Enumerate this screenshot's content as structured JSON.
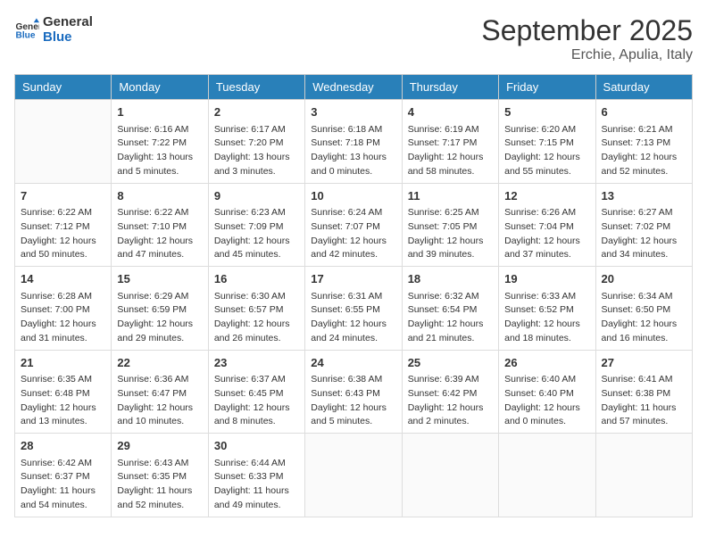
{
  "header": {
    "logo_line1": "General",
    "logo_line2": "Blue",
    "month": "September 2025",
    "location": "Erchie, Apulia, Italy"
  },
  "weekdays": [
    "Sunday",
    "Monday",
    "Tuesday",
    "Wednesday",
    "Thursday",
    "Friday",
    "Saturday"
  ],
  "weeks": [
    [
      {
        "day": "",
        "info": ""
      },
      {
        "day": "1",
        "info": "Sunrise: 6:16 AM\nSunset: 7:22 PM\nDaylight: 13 hours\nand 5 minutes."
      },
      {
        "day": "2",
        "info": "Sunrise: 6:17 AM\nSunset: 7:20 PM\nDaylight: 13 hours\nand 3 minutes."
      },
      {
        "day": "3",
        "info": "Sunrise: 6:18 AM\nSunset: 7:18 PM\nDaylight: 13 hours\nand 0 minutes."
      },
      {
        "day": "4",
        "info": "Sunrise: 6:19 AM\nSunset: 7:17 PM\nDaylight: 12 hours\nand 58 minutes."
      },
      {
        "day": "5",
        "info": "Sunrise: 6:20 AM\nSunset: 7:15 PM\nDaylight: 12 hours\nand 55 minutes."
      },
      {
        "day": "6",
        "info": "Sunrise: 6:21 AM\nSunset: 7:13 PM\nDaylight: 12 hours\nand 52 minutes."
      }
    ],
    [
      {
        "day": "7",
        "info": "Sunrise: 6:22 AM\nSunset: 7:12 PM\nDaylight: 12 hours\nand 50 minutes."
      },
      {
        "day": "8",
        "info": "Sunrise: 6:22 AM\nSunset: 7:10 PM\nDaylight: 12 hours\nand 47 minutes."
      },
      {
        "day": "9",
        "info": "Sunrise: 6:23 AM\nSunset: 7:09 PM\nDaylight: 12 hours\nand 45 minutes."
      },
      {
        "day": "10",
        "info": "Sunrise: 6:24 AM\nSunset: 7:07 PM\nDaylight: 12 hours\nand 42 minutes."
      },
      {
        "day": "11",
        "info": "Sunrise: 6:25 AM\nSunset: 7:05 PM\nDaylight: 12 hours\nand 39 minutes."
      },
      {
        "day": "12",
        "info": "Sunrise: 6:26 AM\nSunset: 7:04 PM\nDaylight: 12 hours\nand 37 minutes."
      },
      {
        "day": "13",
        "info": "Sunrise: 6:27 AM\nSunset: 7:02 PM\nDaylight: 12 hours\nand 34 minutes."
      }
    ],
    [
      {
        "day": "14",
        "info": "Sunrise: 6:28 AM\nSunset: 7:00 PM\nDaylight: 12 hours\nand 31 minutes."
      },
      {
        "day": "15",
        "info": "Sunrise: 6:29 AM\nSunset: 6:59 PM\nDaylight: 12 hours\nand 29 minutes."
      },
      {
        "day": "16",
        "info": "Sunrise: 6:30 AM\nSunset: 6:57 PM\nDaylight: 12 hours\nand 26 minutes."
      },
      {
        "day": "17",
        "info": "Sunrise: 6:31 AM\nSunset: 6:55 PM\nDaylight: 12 hours\nand 24 minutes."
      },
      {
        "day": "18",
        "info": "Sunrise: 6:32 AM\nSunset: 6:54 PM\nDaylight: 12 hours\nand 21 minutes."
      },
      {
        "day": "19",
        "info": "Sunrise: 6:33 AM\nSunset: 6:52 PM\nDaylight: 12 hours\nand 18 minutes."
      },
      {
        "day": "20",
        "info": "Sunrise: 6:34 AM\nSunset: 6:50 PM\nDaylight: 12 hours\nand 16 minutes."
      }
    ],
    [
      {
        "day": "21",
        "info": "Sunrise: 6:35 AM\nSunset: 6:48 PM\nDaylight: 12 hours\nand 13 minutes."
      },
      {
        "day": "22",
        "info": "Sunrise: 6:36 AM\nSunset: 6:47 PM\nDaylight: 12 hours\nand 10 minutes."
      },
      {
        "day": "23",
        "info": "Sunrise: 6:37 AM\nSunset: 6:45 PM\nDaylight: 12 hours\nand 8 minutes."
      },
      {
        "day": "24",
        "info": "Sunrise: 6:38 AM\nSunset: 6:43 PM\nDaylight: 12 hours\nand 5 minutes."
      },
      {
        "day": "25",
        "info": "Sunrise: 6:39 AM\nSunset: 6:42 PM\nDaylight: 12 hours\nand 2 minutes."
      },
      {
        "day": "26",
        "info": "Sunrise: 6:40 AM\nSunset: 6:40 PM\nDaylight: 12 hours\nand 0 minutes."
      },
      {
        "day": "27",
        "info": "Sunrise: 6:41 AM\nSunset: 6:38 PM\nDaylight: 11 hours\nand 57 minutes."
      }
    ],
    [
      {
        "day": "28",
        "info": "Sunrise: 6:42 AM\nSunset: 6:37 PM\nDaylight: 11 hours\nand 54 minutes."
      },
      {
        "day": "29",
        "info": "Sunrise: 6:43 AM\nSunset: 6:35 PM\nDaylight: 11 hours\nand 52 minutes."
      },
      {
        "day": "30",
        "info": "Sunrise: 6:44 AM\nSunset: 6:33 PM\nDaylight: 11 hours\nand 49 minutes."
      },
      {
        "day": "",
        "info": ""
      },
      {
        "day": "",
        "info": ""
      },
      {
        "day": "",
        "info": ""
      },
      {
        "day": "",
        "info": ""
      }
    ]
  ]
}
